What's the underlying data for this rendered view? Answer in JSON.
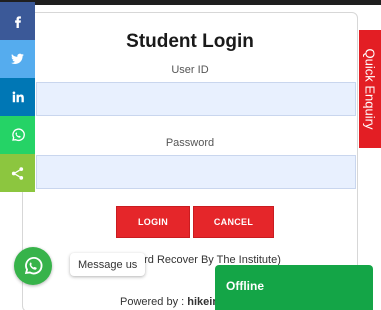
{
  "login": {
    "title": "Student Login",
    "userid_label": "User ID",
    "userid_value": "",
    "password_label": "Password",
    "password_value": "",
    "login_button": "LOGIN",
    "cancel_button": "CANCEL",
    "note": "ord Recover By The Institute)",
    "powered_prefix": "Powered by : ",
    "powered_name": "hikein"
  },
  "share": {
    "items": [
      {
        "name": "facebook",
        "icon": "facebook-icon",
        "color": "#3b5998"
      },
      {
        "name": "twitter",
        "icon": "twitter-icon",
        "color": "#55acee"
      },
      {
        "name": "linkedin",
        "icon": "linkedin-icon",
        "color": "#0077b5"
      },
      {
        "name": "whatsapp",
        "icon": "whatsapp-icon",
        "color": "#25d366"
      },
      {
        "name": "share",
        "icon": "share-icon",
        "color": "#8cc63f"
      }
    ]
  },
  "quick_enquiry": "Quick Enquiry",
  "chat": {
    "message_label": "Message us",
    "status": "Offline"
  },
  "colors": {
    "accent_red": "#e5262a",
    "field_bg": "#e8f0fe",
    "offline_green": "#14a547"
  }
}
